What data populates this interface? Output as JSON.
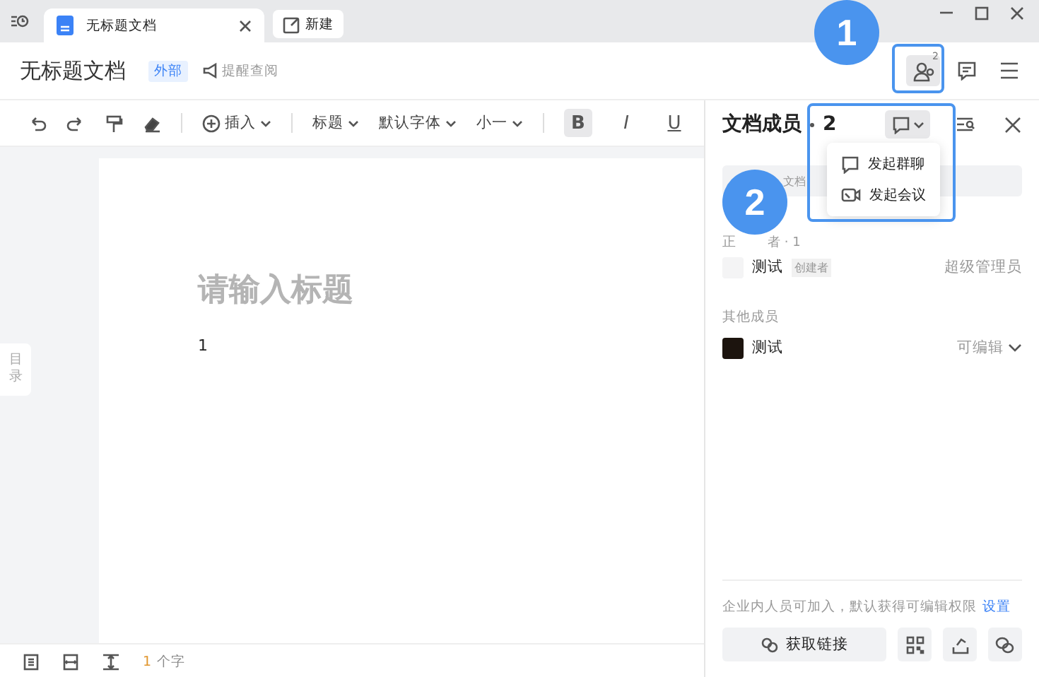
{
  "tabs": [
    {
      "label": "无标题文档",
      "selected": true,
      "closable": true
    },
    {
      "label": "新建",
      "selected": false,
      "closable": false
    }
  ],
  "document": {
    "title": "无标题文档",
    "badge": "外部",
    "remind": "提醒查阅",
    "members_badge": "2"
  },
  "toolbar": {
    "insert": "插入",
    "dropdowns": [
      "标题",
      "默认字体",
      "小一"
    ],
    "formats": [
      {
        "label": "B",
        "kind": "bold",
        "selected": true
      },
      {
        "label": "I",
        "kind": "italic",
        "selected": false
      },
      {
        "label": "U",
        "kind": "underline",
        "selected": false
      }
    ]
  },
  "outline_tab": "目录",
  "page": {
    "title_placeholder": "请输入标题",
    "body": "1"
  },
  "status_bar": {
    "count": "1",
    "unit": "个字"
  },
  "panel": {
    "title": "文档成员",
    "count": "2",
    "search_placeholder": "文档",
    "groups": [
      {
        "heading": "正",
        "heading_rest": "者 · 1",
        "members": [
          {
            "name": "测试",
            "tag": "创建者",
            "role": "超级管理员",
            "dropdown": false,
            "color": "#f4f4f5"
          }
        ]
      },
      {
        "heading": "其他成员",
        "members": [
          {
            "name": "测试",
            "role": "可编辑",
            "dropdown": true,
            "color": "#1c140e"
          }
        ]
      }
    ],
    "footer_note": "企业内人员可加入，默认获得可编辑权限",
    "footer_link": "设置",
    "get_link": "获取链接"
  },
  "menu": {
    "items": [
      {
        "label": "发起群聊",
        "kind": "chat"
      },
      {
        "label": "发起会议",
        "kind": "video"
      }
    ]
  },
  "annotations": [
    {
      "label": "1"
    },
    {
      "label": "2"
    }
  ]
}
